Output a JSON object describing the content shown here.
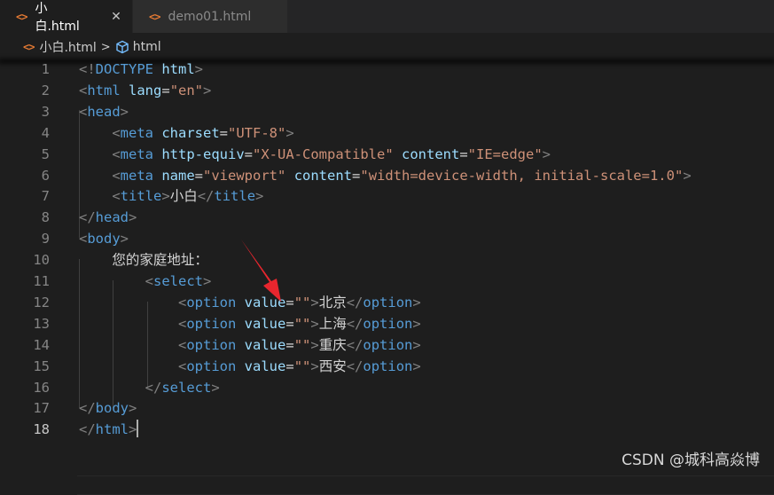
{
  "tabs": [
    {
      "icon": "<>",
      "label": "小白.html",
      "active": true,
      "close": "✕"
    },
    {
      "icon": "<>",
      "label": "demo01.html",
      "active": false,
      "close": "✕"
    }
  ],
  "breadcrumb": {
    "icon": "<>",
    "file": "小白.html",
    "separator": ">",
    "symbol": "html"
  },
  "editor": {
    "lines": [
      {
        "n": "1",
        "text": "<!DOCTYPE html>"
      },
      {
        "n": "2",
        "text": "<html lang=\"en\">"
      },
      {
        "n": "3",
        "text": "<head>"
      },
      {
        "n": "4",
        "text": "    <meta charset=\"UTF-8\">"
      },
      {
        "n": "5",
        "text": "    <meta http-equiv=\"X-UA-Compatible\" content=\"IE=edge\">"
      },
      {
        "n": "6",
        "text": "    <meta name=\"viewport\" content=\"width=device-width, initial-scale=1.0\">"
      },
      {
        "n": "7",
        "text": "    <title>小白</title>"
      },
      {
        "n": "8",
        "text": "</head>"
      },
      {
        "n": "9",
        "text": "<body>"
      },
      {
        "n": "10",
        "text": "    您的家庭地址："
      },
      {
        "n": "11",
        "text": "        <select>"
      },
      {
        "n": "12",
        "text": "            <option value=\"\">北京</option>"
      },
      {
        "n": "13",
        "text": "            <option value=\"\">上海</option>"
      },
      {
        "n": "14",
        "text": "            <option value=\"\">重庆</option>"
      },
      {
        "n": "15",
        "text": "            <option value=\"\">西安</option>"
      },
      {
        "n": "16",
        "text": "        </select>"
      },
      {
        "n": "17",
        "text": "</body>"
      },
      {
        "n": "18",
        "text": "</html>"
      }
    ],
    "current_line": "18"
  },
  "watermark": "CSDN @城科高焱博",
  "colors": {
    "tag": "#569cd6",
    "attribute": "#9cdcfe",
    "string": "#ce9178",
    "punctuation": "#808080",
    "text": "#d4d4d4",
    "background": "#1e1e1e",
    "annotation_arrow": "#e8262e"
  }
}
